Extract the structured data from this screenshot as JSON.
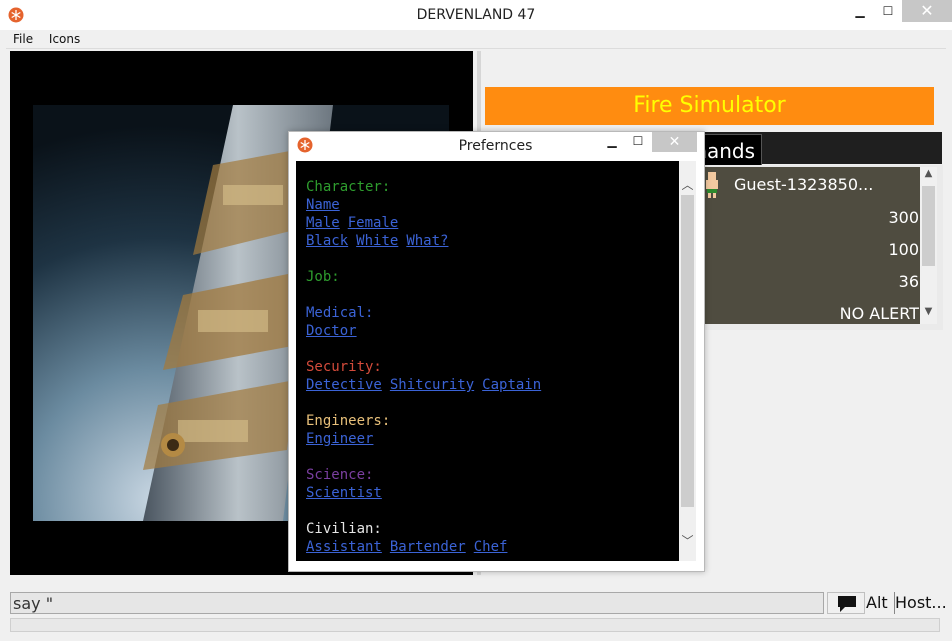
{
  "window": {
    "title": "DERVENLAND 47",
    "minimize": "▁",
    "maximize": "☐",
    "close": "✕"
  },
  "menu": [
    "File",
    "Icons"
  ],
  "banner": {
    "label": "Fire Simulator",
    "bg": "#ff8c10",
    "fg": "#ffff00"
  },
  "tab": {
    "label": "Commands"
  },
  "status": {
    "player_name": "Guest-1323850...",
    "lines": [
      "300",
      "100",
      "36",
      "NO ALERT"
    ]
  },
  "preferences": {
    "title": "Prefernces",
    "sections": [
      {
        "heading": "Character:",
        "color": "#2e9d2e",
        "rows": [
          [
            "Name"
          ],
          [
            "Male",
            "Female"
          ],
          [
            "Black",
            "White",
            "What?"
          ]
        ]
      },
      {
        "heading": "Job:",
        "color": "#2e9d2e",
        "rows": []
      },
      {
        "heading": "Medical:",
        "color": "#3b63d6",
        "rows": [
          [
            "Doctor"
          ]
        ]
      },
      {
        "heading": "Security:",
        "color": "#d34b3b",
        "rows": [
          [
            "Detective",
            "Shitcurity",
            "Captain"
          ]
        ]
      },
      {
        "heading": "Engineers:",
        "color": "#e8c07a",
        "rows": [
          [
            "Engineer"
          ]
        ]
      },
      {
        "heading": "Science:",
        "color": "#7a3fa0",
        "rows": [
          [
            "Scientist"
          ]
        ]
      },
      {
        "heading": "Civilian:",
        "color": "#e6e6e6",
        "rows": [
          [
            "Assistant",
            "Bartender",
            "Chef"
          ]
        ]
      }
    ]
  },
  "input": {
    "value": "say \""
  },
  "buttons": {
    "alt": "Alt",
    "host": "Host..."
  },
  "icons": {
    "app": "snowflake-badge-icon",
    "chat": "speech-bubble-icon",
    "avatar": "player-sprite-icon"
  }
}
